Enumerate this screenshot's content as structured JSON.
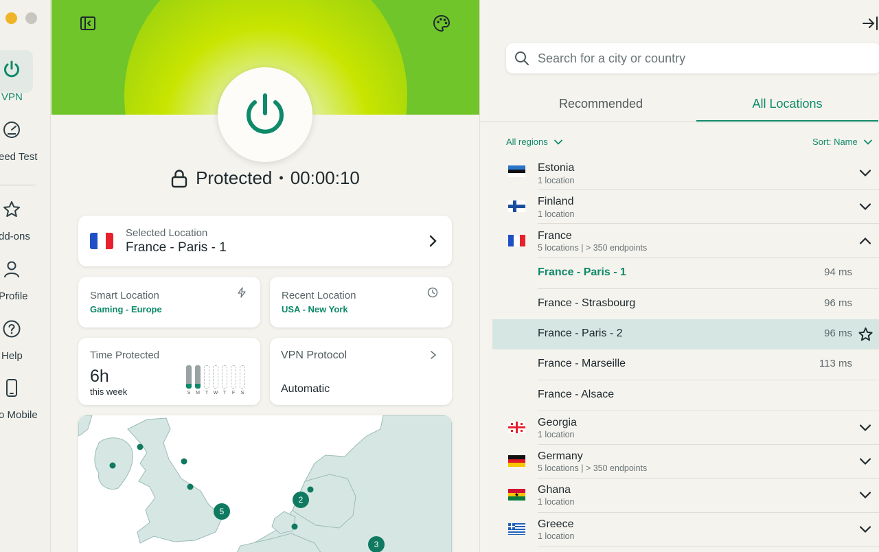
{
  "sidebar": {
    "items": [
      {
        "label": "VPN"
      },
      {
        "label": "eed Test"
      },
      {
        "label": "dd-ons"
      },
      {
        "label": "Profile"
      },
      {
        "label": "Help"
      },
      {
        "label": "o Mobile"
      }
    ]
  },
  "main": {
    "status_text": "Protected",
    "timer": "00:00:10",
    "selected_location": {
      "label": "Selected Location",
      "value": "France - Paris - 1"
    },
    "smart_location": {
      "label": "Smart Location",
      "value": "Gaming - Europe"
    },
    "recent_location": {
      "label": "Recent Location",
      "value": "USA - New York"
    },
    "time_protected": {
      "label": "Time Protected",
      "value": "6h",
      "sub": "this week",
      "days": [
        "S",
        "M",
        "T",
        "W",
        "T",
        "F",
        "S"
      ],
      "day_fractions": [
        0.2,
        0.2,
        0,
        0,
        0,
        0,
        0
      ]
    },
    "vpn_protocol": {
      "label": "VPN Protocol",
      "value": "Automatic"
    },
    "map_clusters": [
      "2",
      "5",
      "3"
    ]
  },
  "search": {
    "placeholder": "Search for a city or country"
  },
  "tabs": [
    {
      "label": "Recommended"
    },
    {
      "label": "All Locations"
    }
  ],
  "filters": {
    "region": "All regions",
    "sort": "Sort: Name"
  },
  "countries": [
    {
      "name": "Estonia",
      "sub": "1 location"
    },
    {
      "name": "Finland",
      "sub": "1 location"
    },
    {
      "name": "France",
      "sub": "5 locations | > 350 endpoints"
    },
    {
      "name": "Georgia",
      "sub": "1 location"
    },
    {
      "name": "Germany",
      "sub": "5 locations | > 350 endpoints"
    },
    {
      "name": "Ghana",
      "sub": "1 location"
    },
    {
      "name": "Greece",
      "sub": "1 location"
    }
  ],
  "france_locations": [
    {
      "name": "France - Paris - 1",
      "ms": "94 ms"
    },
    {
      "name": "France - Strasbourg",
      "ms": "96 ms"
    },
    {
      "name": "France - Paris - 2",
      "ms": "96 ms"
    },
    {
      "name": "France - Marseille",
      "ms": "113 ms"
    },
    {
      "name": "France - Alsace",
      "ms": ""
    }
  ],
  "colors": {
    "accent": "#0e8a6a",
    "hover_row": "#d6e6e3",
    "hero_green": "#8fd21a"
  }
}
